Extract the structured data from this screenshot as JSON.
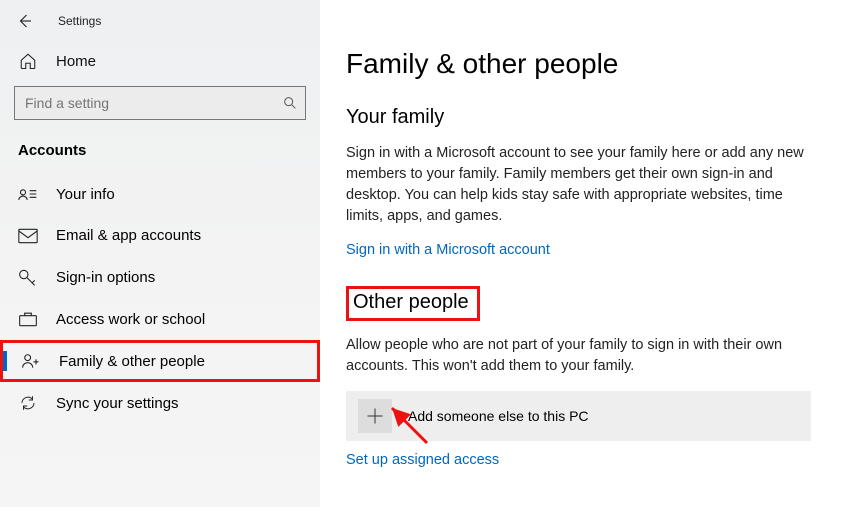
{
  "window": {
    "title": "Settings"
  },
  "sidebar": {
    "home_label": "Home",
    "search_placeholder": "Find a setting",
    "category": "Accounts",
    "items": [
      {
        "label": "Your info"
      },
      {
        "label": "Email & app accounts"
      },
      {
        "label": "Sign-in options"
      },
      {
        "label": "Access work or school"
      },
      {
        "label": "Family & other people"
      },
      {
        "label": "Sync your settings"
      }
    ]
  },
  "page": {
    "title": "Family & other people",
    "family": {
      "heading": "Your family",
      "desc": "Sign in with a Microsoft account to see your family here or add any new members to your family. Family members get their own sign-in and desktop. You can help kids stay safe with appropriate websites, time limits, apps, and games.",
      "link": "Sign in with a Microsoft account"
    },
    "other": {
      "heading": "Other people",
      "desc": "Allow people who are not part of your family to sign in with their own accounts. This won't add them to your family.",
      "add_label": "Add someone else to this PC",
      "assigned_link": "Set up assigned access"
    }
  }
}
